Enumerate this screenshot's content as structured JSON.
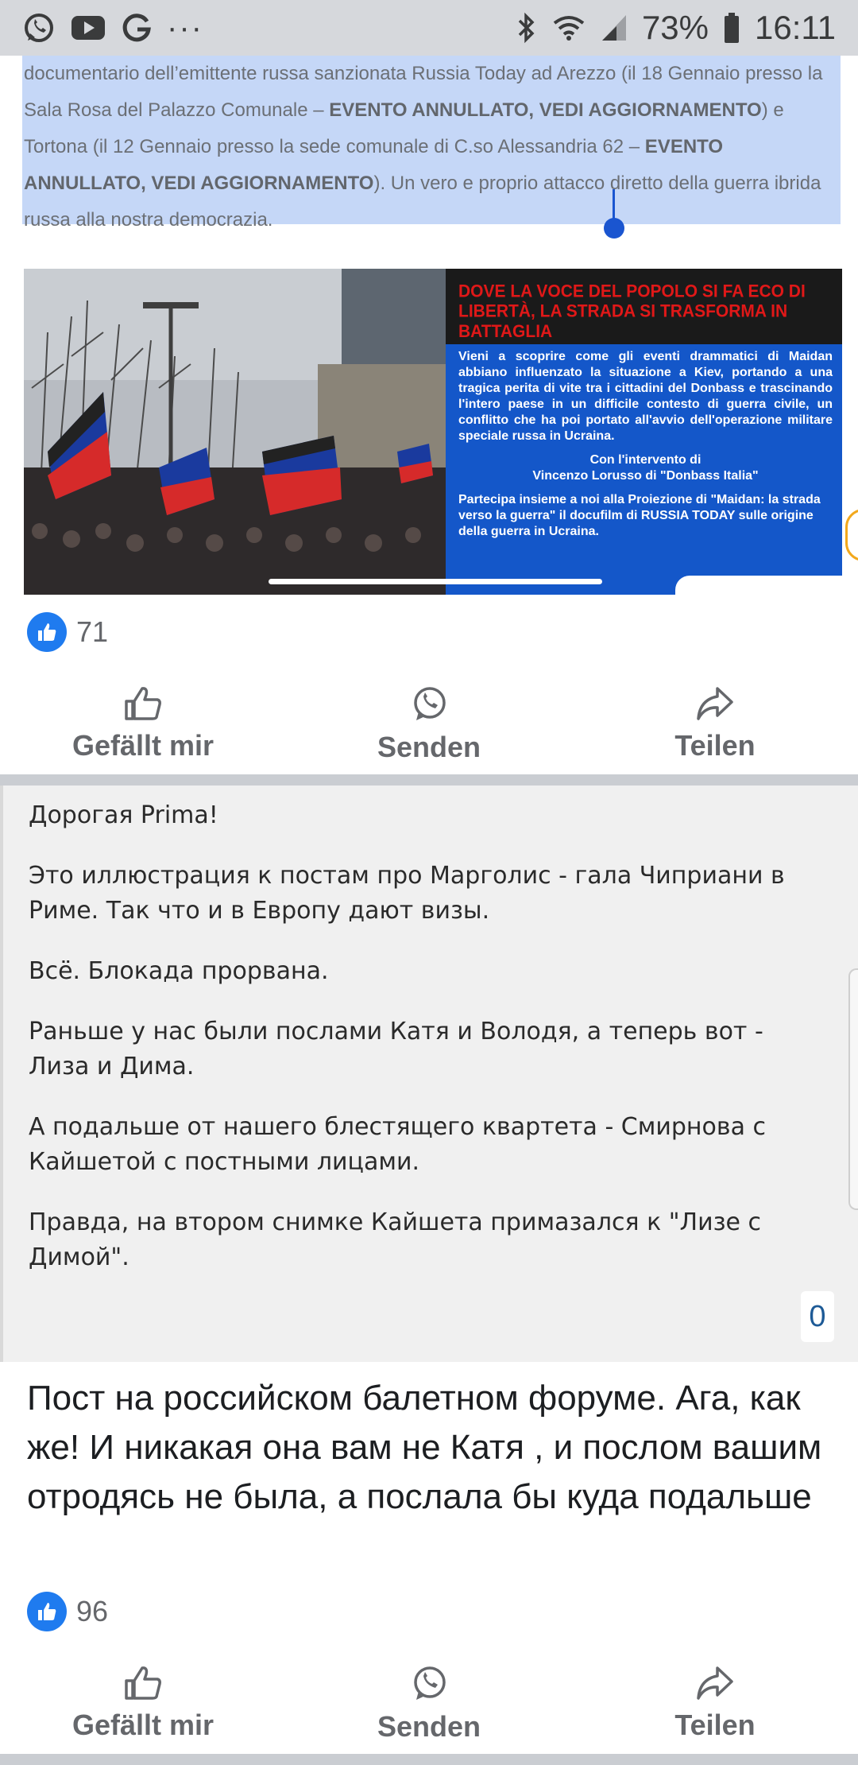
{
  "status_bar": {
    "battery": "73%",
    "time": "16:11",
    "left_icons": [
      "whatsapp-icon",
      "youtube-icon",
      "google-icon",
      "more-icon"
    ],
    "right_icons": [
      "bluetooth-icon",
      "wifi-icon",
      "signal-icon",
      "battery-icon"
    ]
  },
  "article": {
    "segments": [
      {
        "text": "documentario dell’emittente russa sanzionata Russia Today ad Arezzo (il 18 Gennaio presso la Sala Rosa del Palazzo Comunale – ",
        "bold": false
      },
      {
        "text": "EVENTO ANNULLATO, VEDI AGGIORNAMENTO",
        "bold": true
      },
      {
        "text": ") e Tortona (il 12 Gennaio presso la sede comunale di C.so Alessandria 62 – ",
        "bold": false
      },
      {
        "text": "EVENTO ANNULLATO, VEDI AGGIORNAMENTO",
        "bold": true
      },
      {
        "text": "). Un vero e proprio attacco diretto della guerra ibrida russa alla nostra democrazia.",
        "bold": false
      }
    ],
    "highlight_color": "#c5d7f7",
    "selection_color": "#1a55d0"
  },
  "image": {
    "headline": "DOVE LA VOCE DEL POPOLO SI FA ECO DI LIBERTÀ, LA STRADA SI TRASFORMA IN BATTAGLIA",
    "body": "Vieni a scoprire come gli eventi drammatici di Maidan abbiano influenzato la situazione a Kiev, portando a una tragica perita di vite tra i cittadini del Donbass e trascinando l'intero paese in un difficile contesto di guerra civile, un conflitto che ha poi portato all'avvio dell'operazione militare speciale russa in Ucraina.",
    "speaker": "Con l'intervento di\nVincenzo Lorusso di \"Donbass Italia\"",
    "invite": "Partecipa insieme a noi alla Proiezione di \"Maidan: la strada verso la guerra\" il docufilm di RUSSIA TODAY sulle origine della guerra in Ucraina.",
    "flyer_blue": "#1457c9",
    "headline_red": "#e01818"
  },
  "post1": {
    "like_count": "71",
    "actions": {
      "like": "Gefällt mir",
      "send": "Senden",
      "share": "Teilen"
    }
  },
  "forum": {
    "paragraphs": [
      "Дорогая Prima!",
      "Это иллюстрация к постам про Марголис - гала Чиприани в Риме. Так что и в Европу дают визы.",
      "Всё. Блокада прорвана.",
      "Раньше у нас были послами Катя и Володя, а теперь вот - Лиза и Дима.",
      "А подальше от нашего блестящего квартета - Смирнова с Кайшетой с постными лицами.",
      "Правда, на втором снимке Кайшета примазался к \"Лизе с Димой\"."
    ],
    "count": "0"
  },
  "post2": {
    "caption": "Пост на российском балетном форуме. Ага, как же! И никакая она вам не Катя , и послом вашим отродясь не была, а послала бы куда подальше",
    "like_count": "96",
    "actions": {
      "like": "Gefällt mir",
      "send": "Senden",
      "share": "Teilen"
    }
  },
  "colors": {
    "facebook_blue": "#1f7bef",
    "action_gray": "#65676b"
  }
}
